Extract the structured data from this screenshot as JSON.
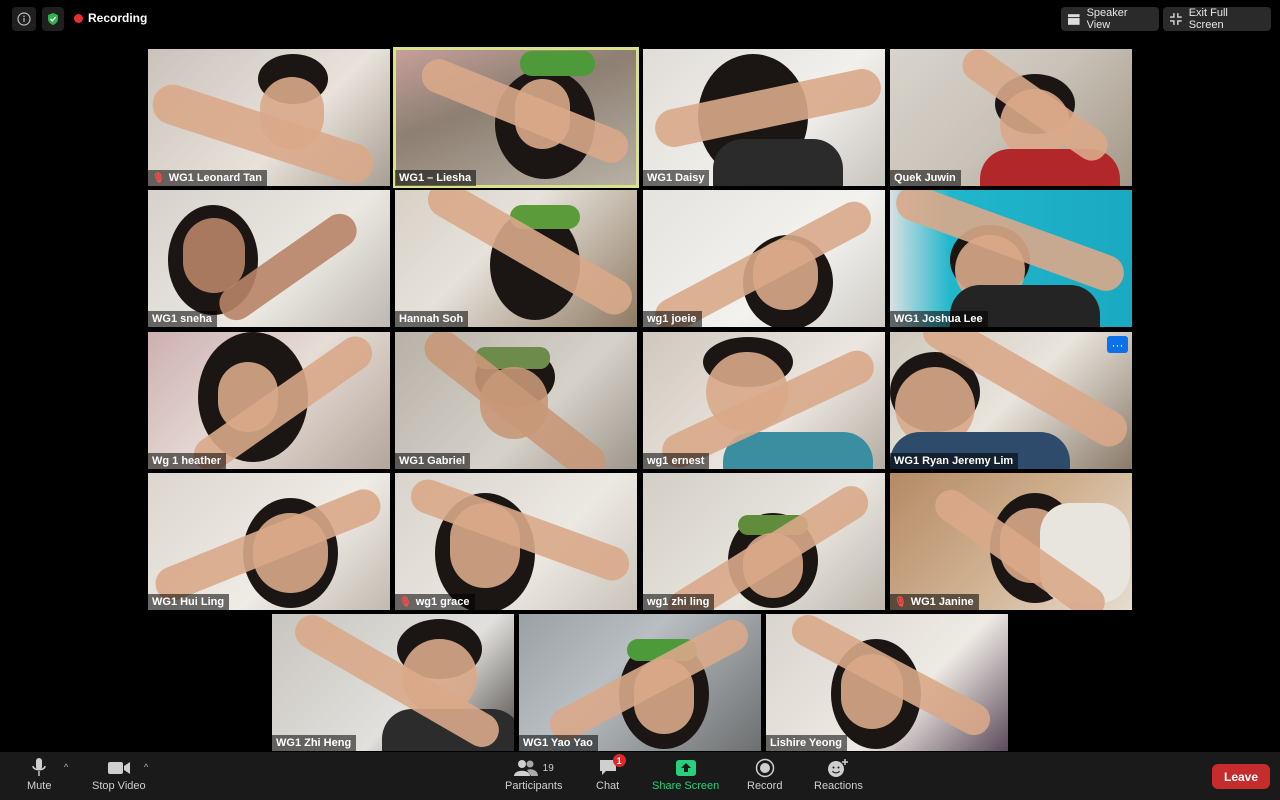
{
  "topbar": {
    "recording_label": "Recording",
    "speaker_view_label": "Speaker View",
    "exit_fullscreen_label": "Exit Full Screen",
    "icons": [
      "info-icon",
      "security-shield-icon",
      "speaker-view-icon",
      "exit-fullscreen-icon"
    ],
    "recording_color": "#e8312f"
  },
  "participants": [
    {
      "name": "WG1 Leonard Tan",
      "muted": true
    },
    {
      "name": "WG1 – Liesha",
      "muted": false,
      "active_speaker": true
    },
    {
      "name": "WG1 Daisy",
      "muted": false
    },
    {
      "name": "Quek Juwin",
      "muted": false
    },
    {
      "name": "WG1 sneha",
      "muted": false
    },
    {
      "name": "Hannah Soh",
      "muted": false
    },
    {
      "name": "wg1 joeie",
      "muted": false
    },
    {
      "name": "WG1 Joshua Lee",
      "muted": false
    },
    {
      "name": "Wg 1 heather",
      "muted": false
    },
    {
      "name": "WG1 Gabriel",
      "muted": false
    },
    {
      "name": "wg1 ernest",
      "muted": false
    },
    {
      "name": "WG1 Ryan Jeremy Lim",
      "muted": false,
      "more_button": true
    },
    {
      "name": "WG1 Hui Ling",
      "muted": false
    },
    {
      "name": "wg1 grace",
      "muted": true
    },
    {
      "name": "wg1 zhi ling",
      "muted": false
    },
    {
      "name": "WG1 Janine",
      "muted": true
    },
    {
      "name": "WG1 Zhi Heng",
      "muted": false
    },
    {
      "name": "WG1 Yao Yao",
      "muted": false
    },
    {
      "name": "Lishire Yeong",
      "muted": false
    }
  ],
  "toolbar": {
    "mute_label": "Mute",
    "stop_video_label": "Stop Video",
    "participants_label": "Participants",
    "participants_count": "19",
    "chat_label": "Chat",
    "chat_badge": "1",
    "share_screen_label": "Share Screen",
    "record_label": "Record",
    "reactions_label": "Reactions",
    "leave_label": "Leave",
    "share_color": "#26d07c",
    "leave_color": "#c72c2c",
    "active_speaker_border_color": "#d9e18a"
  }
}
